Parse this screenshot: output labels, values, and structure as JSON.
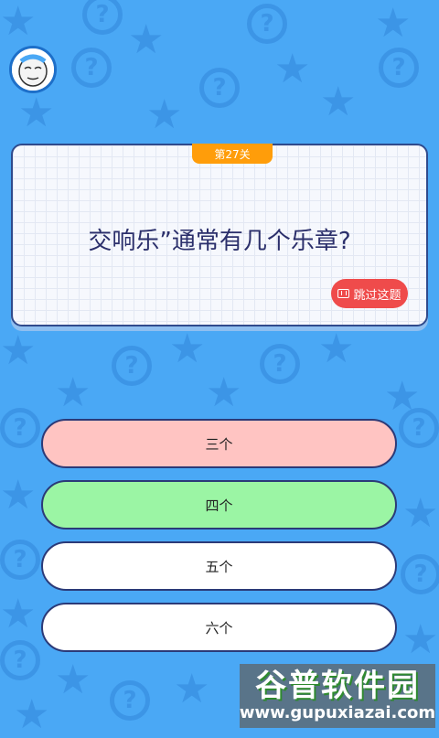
{
  "level": {
    "label": "第27关",
    "color": "#ff9d0a"
  },
  "question": {
    "text": "交响乐”通常有几个乐章?"
  },
  "skip": {
    "label": "跳过这题",
    "icon": "ticket-icon",
    "color": "#ef4b4b"
  },
  "options": [
    {
      "label": "三个",
      "state": "wrong",
      "color": "#ffc4c2"
    },
    {
      "label": "四个",
      "state": "correct",
      "color": "#9bf5a4"
    },
    {
      "label": "五个",
      "state": "normal",
      "color": "#ffffff"
    },
    {
      "label": "六个",
      "state": "normal",
      "color": "#ffffff"
    }
  ],
  "watermark": {
    "title": "谷普软件园",
    "url": "www.gupuxiazai.com"
  },
  "avatar": {
    "icon": "player-avatar-icon"
  },
  "theme": {
    "background": "#4aa8f5",
    "card_border": "#2f4a8c"
  }
}
